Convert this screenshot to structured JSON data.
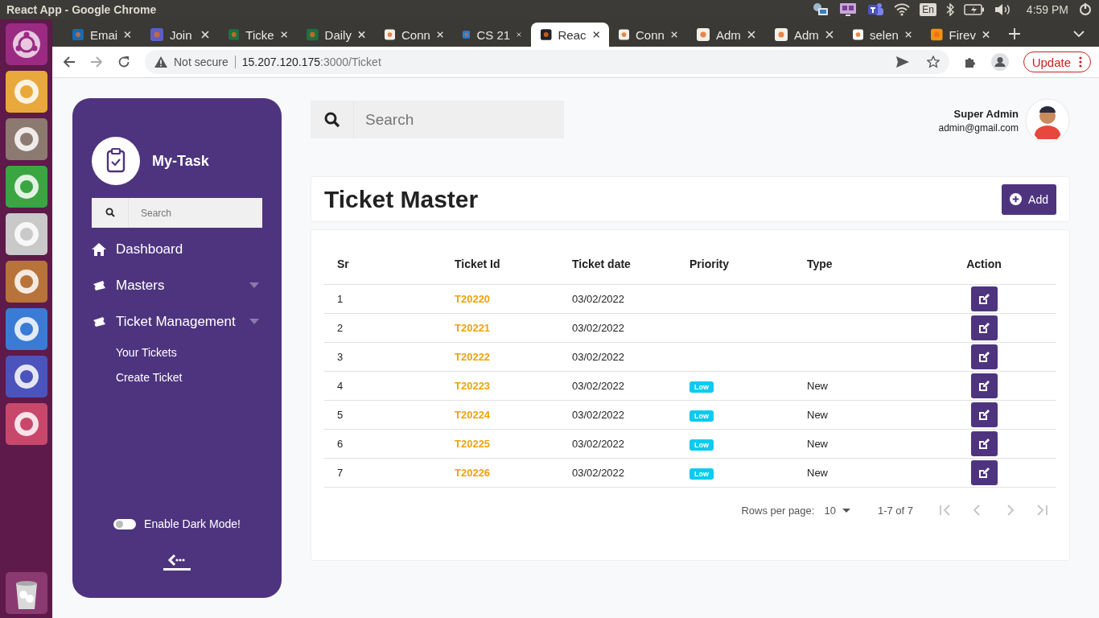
{
  "top_panel": {
    "title": "React App - Google Chrome",
    "keyboard": "En",
    "clock": "4:59 PM"
  },
  "browser": {
    "tabs": [
      {
        "title": "Emai",
        "selected": false
      },
      {
        "title": "Join",
        "selected": false
      },
      {
        "title": "Ticke",
        "selected": false
      },
      {
        "title": "Daily",
        "selected": false
      },
      {
        "title": "Conn",
        "selected": false
      },
      {
        "title": "CS 21",
        "selected": false
      },
      {
        "title": "Reac",
        "selected": true
      },
      {
        "title": "Conn",
        "selected": false
      },
      {
        "title": "Adm",
        "selected": false
      },
      {
        "title": "Adm",
        "selected": false
      },
      {
        "title": "selen",
        "selected": false
      },
      {
        "title": "Firev",
        "selected": false
      }
    ],
    "security": "Not secure",
    "host": "15.207.120.175",
    "path": ":3000/Ticket",
    "update_button": "Update"
  },
  "sidebar": {
    "brand": "My-Task",
    "search_placeholder": "Search",
    "nav": [
      {
        "label": "Dashboard",
        "kind": "home"
      },
      {
        "label": "Masters",
        "kind": "group"
      },
      {
        "label": "Ticket Management",
        "kind": "group",
        "children": [
          {
            "label": "Your Tickets"
          },
          {
            "label": "Create Ticket"
          }
        ]
      }
    ],
    "dark_mode": {
      "label": "Enable Dark Mode!",
      "on": false
    }
  },
  "header": {
    "search_placeholder": "Search",
    "user_name": "Super Admin",
    "user_email": "admin@gmail.com"
  },
  "page": {
    "title": "Ticket Master",
    "add_button": "Add"
  },
  "table": {
    "columns": [
      "Sr",
      "Ticket Id",
      "Ticket date",
      "Priority",
      "Type",
      "Action"
    ],
    "rows": [
      {
        "sr": "1",
        "id": "T20220",
        "date": "03/02/2022"
      },
      {
        "sr": "2",
        "id": "T20221",
        "date": "03/02/2022"
      },
      {
        "sr": "3",
        "id": "T20222",
        "date": "03/02/2022"
      },
      {
        "sr": "4",
        "id": "T20223",
        "date": "03/02/2022",
        "priority": "Low",
        "type": "New"
      },
      {
        "sr": "5",
        "id": "T20224",
        "date": "03/02/2022",
        "priority": "Low",
        "type": "New"
      },
      {
        "sr": "6",
        "id": "T20225",
        "date": "03/02/2022",
        "priority": "Low",
        "type": "New"
      },
      {
        "sr": "7",
        "id": "T20226",
        "date": "03/02/2022",
        "priority": "Low",
        "type": "New"
      }
    ]
  },
  "pagination": {
    "rows_per_page_label": "Rows per page:",
    "rows_per_page": "10",
    "range": "1-7 of 7",
    "buttons": [
      {
        "kind": "first",
        "disabled": true
      },
      {
        "kind": "prev",
        "disabled": true
      },
      {
        "kind": "next",
        "disabled": true
      },
      {
        "kind": "last",
        "disabled": true
      }
    ]
  }
}
